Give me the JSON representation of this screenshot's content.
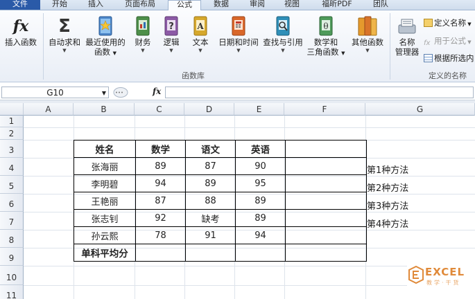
{
  "tabs": [
    "文件",
    "开始",
    "插入",
    "页面布局",
    "公式",
    "数据",
    "审阅",
    "视图",
    "福昕PDF",
    "团队"
  ],
  "ribbon": {
    "buttons": {
      "insert_function": "插入函数",
      "autosum": "自动求和",
      "recent_1": "最近使用的",
      "recent_2": "函数",
      "financial": "财务",
      "logical": "逻辑",
      "text": "文本",
      "datetime": "日期和时间",
      "lookup": "查找与引用",
      "math_1": "数学和",
      "math_2": "三角函数",
      "other": "其他函数",
      "name_mgr_1": "名称",
      "name_mgr_2": "管理器"
    },
    "small": {
      "define_name": "定义名称",
      "use_in_formula": "用于公式",
      "create_from_sel": "根据所选内"
    },
    "groups": {
      "library": "函数库",
      "names": "定义的名称"
    },
    "fx_symbol": "fx",
    "sigma_symbol": "Σ"
  },
  "formula_bar": {
    "name_box": "G10",
    "fx": "fx",
    "formula": ""
  },
  "columns": [
    "A",
    "B",
    "C",
    "D",
    "E",
    "F",
    "G"
  ],
  "rows": [
    "1",
    "2",
    "3",
    "4",
    "5",
    "6",
    "7",
    "8",
    "9",
    "10",
    "11"
  ],
  "table": {
    "headers": [
      "姓名",
      "数学",
      "语文",
      "英语",
      ""
    ],
    "rows": [
      [
        "张海丽",
        "89",
        "87",
        "90",
        ""
      ],
      [
        "李明碧",
        "94",
        "89",
        "95",
        ""
      ],
      [
        "王艳丽",
        "87",
        "88",
        "89",
        ""
      ],
      [
        "张志钊",
        "92",
        "缺考",
        "89",
        ""
      ],
      [
        "孙云熙",
        "78",
        "91",
        "94",
        ""
      ],
      [
        "单科平均分",
        "",
        "",
        "",
        ""
      ]
    ]
  },
  "notes": [
    "第1种方法",
    "第2种方法",
    "第3种方法",
    "第4种方法"
  ],
  "watermark": {
    "main": "EXCEL",
    "sub": "教学·干货"
  }
}
